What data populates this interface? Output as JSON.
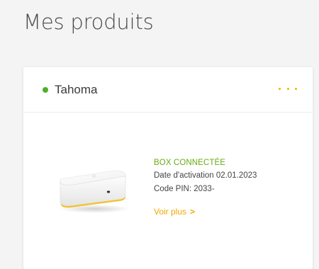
{
  "page": {
    "title": "Mes produits"
  },
  "product": {
    "name": "Tahoma",
    "status_color": "#4caf28",
    "type": "BOX CONNECTÉE",
    "activation": "Date d'activation 02.01.2023",
    "pin": "Code PIN: 2033-",
    "see_more": "Voir plus",
    "see_more_icon": "chevron-right-icon",
    "accent_color": "#f0a800"
  }
}
